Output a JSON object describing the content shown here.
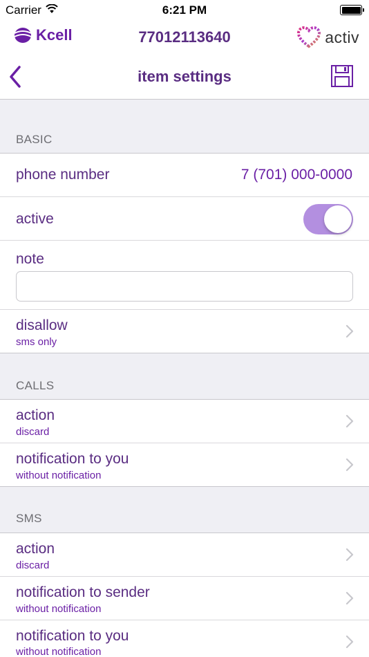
{
  "status_bar": {
    "carrier": "Carrier",
    "time": "6:21 PM",
    "icons": [
      "wifi-icon",
      "battery-icon"
    ]
  },
  "brand_bar": {
    "left_logo": "Kcell",
    "phone": "77012113640",
    "right_logo": "activ"
  },
  "nav": {
    "title": "item settings",
    "back_icon": "chevron-left-icon",
    "save_icon": "floppy-disk-icon"
  },
  "colors": {
    "accent": "#6a1fa5",
    "text_purple": "#5a2d82",
    "toggle_on": "#b38fe0",
    "background": "#efeff4"
  },
  "sections": {
    "basic": {
      "header": "BASIC",
      "phone_label": "phone number",
      "phone_value": "7 (701) 000-0000",
      "active_label": "active",
      "active_on": true,
      "note_label": "note",
      "note_value": "",
      "disallow_label": "disallow",
      "disallow_value": "sms only"
    },
    "calls": {
      "header": "CALLS",
      "action_label": "action",
      "action_value": "discard",
      "notify_you_label": "notification to you",
      "notify_you_value": "without notification"
    },
    "sms": {
      "header": "SMS",
      "action_label": "action",
      "action_value": "discard",
      "notify_sender_label": "notification to sender",
      "notify_sender_value": "without notification",
      "notify_you_label": "notification to you",
      "notify_you_value": "without notification"
    }
  }
}
